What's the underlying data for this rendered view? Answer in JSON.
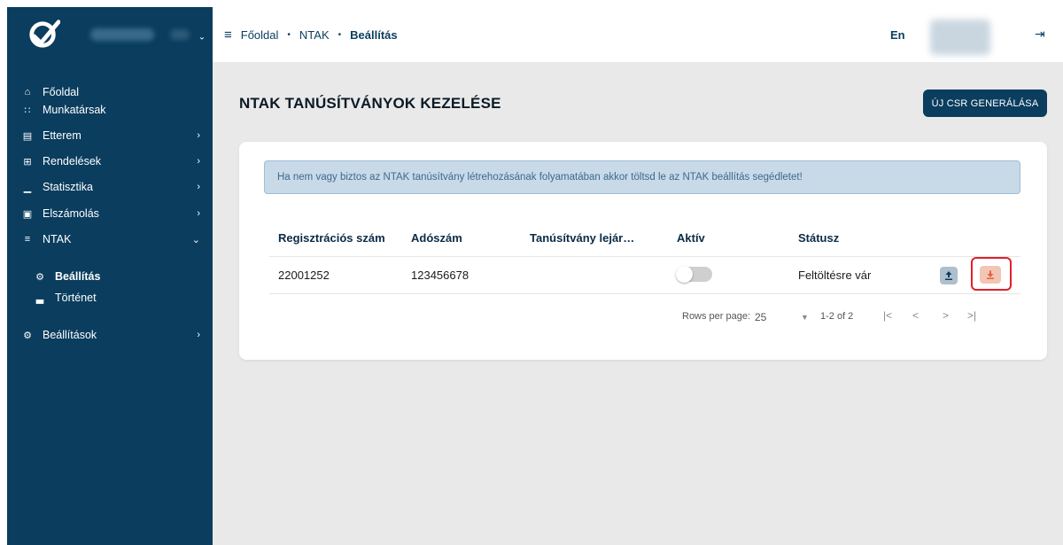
{
  "sidebar": {
    "items": [
      {
        "label": "Főoldal",
        "icon": "home-icon",
        "glyph": "⌂",
        "has_arrow": false
      },
      {
        "label": "Munkatársak",
        "icon": "people-icon",
        "glyph": "∷",
        "has_arrow": false
      },
      {
        "label": "Etterem",
        "icon": "store-icon",
        "glyph": "▤",
        "has_arrow": true
      },
      {
        "label": "Rendelések",
        "icon": "cart-icon",
        "glyph": "⊞",
        "has_arrow": true
      },
      {
        "label": "Statisztika",
        "icon": "chart-icon",
        "glyph": "▁",
        "has_arrow": true
      },
      {
        "label": "Elszámolás",
        "icon": "receipt-icon",
        "glyph": "▣",
        "has_arrow": true
      },
      {
        "label": "NTAK",
        "icon": "signal-icon",
        "glyph": "≡",
        "has_arrow": true,
        "expanded": true
      },
      {
        "label": "Beállítás",
        "icon": "gear-icon",
        "glyph": "⚙",
        "sub": true,
        "active": true
      },
      {
        "label": "Történet",
        "icon": "history-chart-icon",
        "glyph": "▃",
        "sub": true
      },
      {
        "label": "Beállítások",
        "icon": "settings-icon",
        "glyph": "⚙",
        "has_arrow": true
      }
    ]
  },
  "breadcrumb": {
    "items": [
      "Főoldal",
      "NTAK",
      "Beállítás"
    ]
  },
  "topbar": {
    "lang": "En",
    "logout_icon": "logout-icon"
  },
  "page": {
    "title": "NTAK TANÚSÍTVÁNYOK KEZELÉSE",
    "csr_button": "ÚJ CSR GENERÁLÁSA",
    "info": "Ha nem vagy biztos az NTAK tanúsítvány létrehozásának folyamatában akkor töltsd le az NTAK beállítás segédletet!"
  },
  "table": {
    "headers": [
      "Regisztrációs szám",
      "Adószám",
      "Tanúsítvány lejár…",
      "Aktív",
      "Státusz"
    ],
    "rows": [
      {
        "reg": "22001252",
        "tax": "123456678",
        "expiry": "",
        "active": false,
        "status": "Feltöltésre vár"
      }
    ]
  },
  "pagination": {
    "rows_per_page_label": "Rows per page:",
    "rows_per_page": "25",
    "range": "1-2 of 2"
  },
  "colors": {
    "sidebar": "#0a3d5e",
    "highlight": "#e11f2a",
    "download_button": "#f3c5b4",
    "upload_button": "#aebfcd"
  }
}
